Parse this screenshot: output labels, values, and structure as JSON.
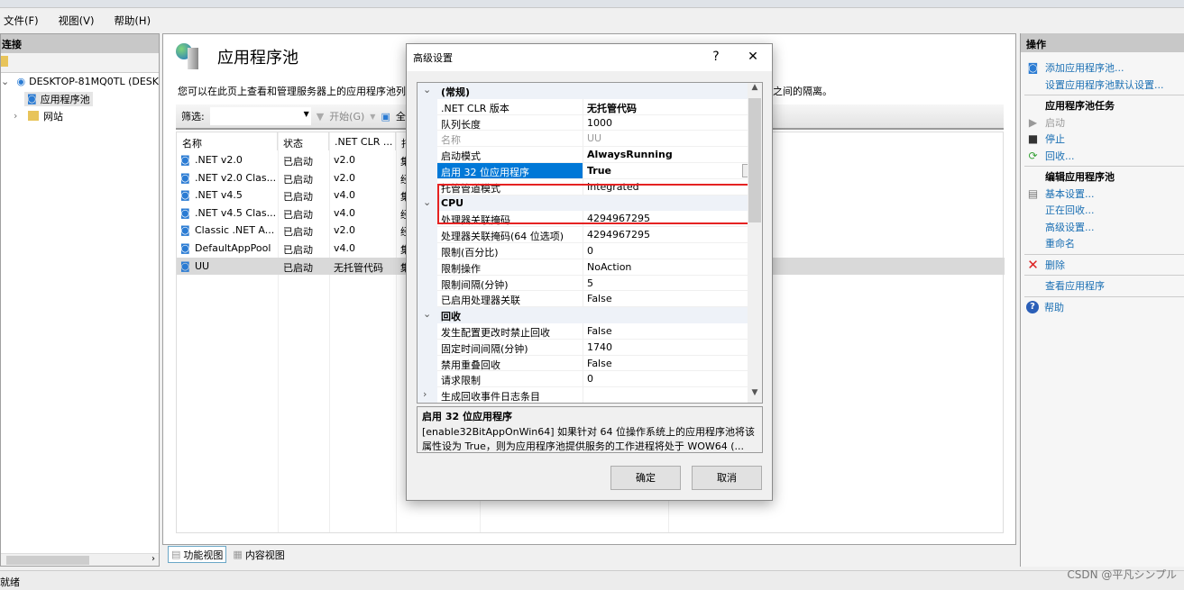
{
  "menu": [
    "文件(F)",
    "视图(V)",
    "帮助(H)"
  ],
  "left": {
    "title": "连接",
    "tree": [
      {
        "label": "DESKTOP-81MQ0TL (DESK",
        "expanded": true
      },
      {
        "label": "应用程序池",
        "selected": true
      },
      {
        "label": "网站",
        "expanded": false
      }
    ]
  },
  "main": {
    "title": "应用程序池",
    "description": "您可以在此页上查看和管理服务器上的应用程序池列表。应用程序池与工作进程相关联，包含一个或多个应用程序，并提供不同应用程序之间的隔离。",
    "filter_label": "筛选:",
    "filter_value": "",
    "start_label": "开始(G)",
    "show_all_label": "全",
    "columns": [
      "名称",
      "状态",
      ".NET CLR ...",
      "托"
    ],
    "rows": [
      {
        "name": ".NET v2.0",
        "status": "已启动",
        "clr": "v2.0",
        "pipeline": "集成"
      },
      {
        "name": ".NET v2.0 Clas...",
        "status": "已启动",
        "clr": "v2.0",
        "pipeline": "经典"
      },
      {
        "name": ".NET v4.5",
        "status": "已启动",
        "clr": "v4.0",
        "pipeline": "集成"
      },
      {
        "name": ".NET v4.5 Clas...",
        "status": "已启动",
        "clr": "v4.0",
        "pipeline": "经典"
      },
      {
        "name": "Classic .NET A...",
        "status": "已启动",
        "clr": "v2.0",
        "pipeline": "经典"
      },
      {
        "name": "DefaultAppPool",
        "status": "已启动",
        "clr": "v4.0",
        "pipeline": "集成"
      },
      {
        "name": "UU",
        "status": "已启动",
        "clr": "无托管代码",
        "pipeline": "集成",
        "selected": true
      }
    ],
    "view_tabs": [
      "功能视图",
      "内容视图"
    ]
  },
  "actions": {
    "title": "操作",
    "add_pool": "添加应用程序池...",
    "set_defaults": "设置应用程序池默认设置...",
    "tasks_title": "应用程序池任务",
    "start": "启动",
    "stop": "停止",
    "recycle": "回收...",
    "edit_title": "编辑应用程序池",
    "basic": "基本设置...",
    "recycling": "正在回收...",
    "advanced": "高级设置...",
    "rename": "重命名",
    "delete": "删除",
    "view_apps": "查看应用程序",
    "help": "帮助"
  },
  "status": "就绪",
  "watermark": "CSDN @平凡シンプル",
  "dialog": {
    "title": "高级设置",
    "help_btn": "?",
    "close_btn": "✕",
    "rows": [
      {
        "type": "cat",
        "label": "(常规)",
        "expanded": true
      },
      {
        "label": ".NET CLR 版本",
        "value": "无托管代码",
        "bold": true
      },
      {
        "label": "队列长度",
        "value": "1000"
      },
      {
        "label": "名称",
        "value": "UU",
        "disabled": true
      },
      {
        "label": "启动模式",
        "value": "AlwaysRunning",
        "bold": true
      },
      {
        "label": "启用 32 位应用程序",
        "value": "True",
        "bold": true,
        "selected": true
      },
      {
        "label": "托管管道模式",
        "value": "Integrated"
      },
      {
        "type": "cat",
        "label": "CPU",
        "expanded": true
      },
      {
        "label": "处理器关联掩码",
        "value": "4294967295"
      },
      {
        "label": "处理器关联掩码(64 位选项)",
        "value": "4294967295"
      },
      {
        "label": "限制(百分比)",
        "value": "0"
      },
      {
        "label": "限制操作",
        "value": "NoAction"
      },
      {
        "label": "限制间隔(分钟)",
        "value": "5"
      },
      {
        "label": "已启用处理器关联",
        "value": "False"
      },
      {
        "type": "cat",
        "label": "回收",
        "expanded": true
      },
      {
        "label": "发生配置更改时禁止回收",
        "value": "False"
      },
      {
        "label": "固定时间间隔(分钟)",
        "value": "1740"
      },
      {
        "label": "禁用重叠回收",
        "value": "False"
      },
      {
        "label": "请求限制",
        "value": "0"
      },
      {
        "label": "生成回收事件日志条目",
        "value": "",
        "collapsed": true
      }
    ],
    "help_title": "启用 32 位应用程序",
    "help_text": "[enable32BitAppOnWin64] 如果针对 64 位操作系统上的应用程序池将该属性设为 True，则为应用程序池提供服务的工作进程将处于 WOW64 (...",
    "ok": "确定",
    "cancel": "取消"
  },
  "colors": {
    "selection": "#0078d7",
    "highlight_box": "#e52222",
    "link": "#1a6fb3"
  }
}
